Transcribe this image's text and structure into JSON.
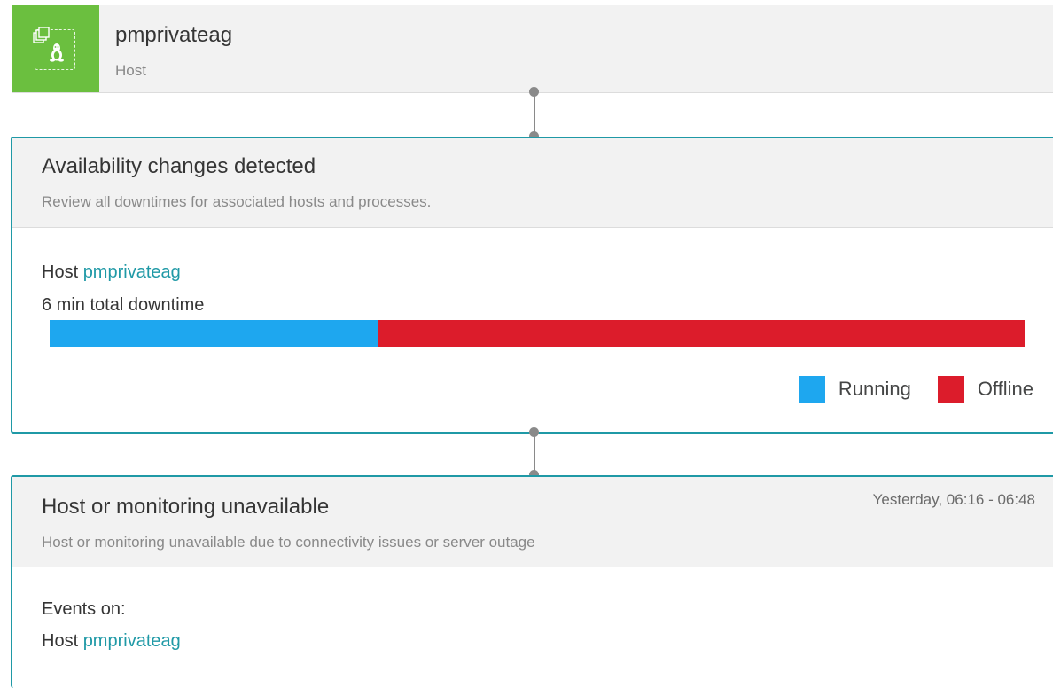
{
  "host": {
    "name": "pmprivateag",
    "type": "Host",
    "icon": "linux-host-icon",
    "tile_color": "#6bbf3f"
  },
  "availability": {
    "title": "Availability changes detected",
    "subtitle": "Review all downtimes for associated hosts and processes.",
    "host_prefix": "Host",
    "host_link": "pmprivateag",
    "downtime": "6 min total downtime",
    "timeline": [
      {
        "state": "Running",
        "fraction": 0.336
      },
      {
        "state": "Offline",
        "fraction": 0.664
      }
    ],
    "legend": [
      {
        "label": "Running",
        "color": "#1ea7ef"
      },
      {
        "label": "Offline",
        "color": "#dc1c2b"
      }
    ]
  },
  "unavailable": {
    "title": "Host or monitoring unavailable",
    "subtitle": "Host or monitoring unavailable due to connectivity issues or server outage",
    "time": "Yesterday, 06:16 - 06:48",
    "events_label": "Events on:",
    "host_prefix": "Host",
    "host_link": "pmprivateag"
  },
  "colors": {
    "accent": "#1f99a6",
    "running": "#1ea7ef",
    "offline": "#dc1c2b"
  }
}
